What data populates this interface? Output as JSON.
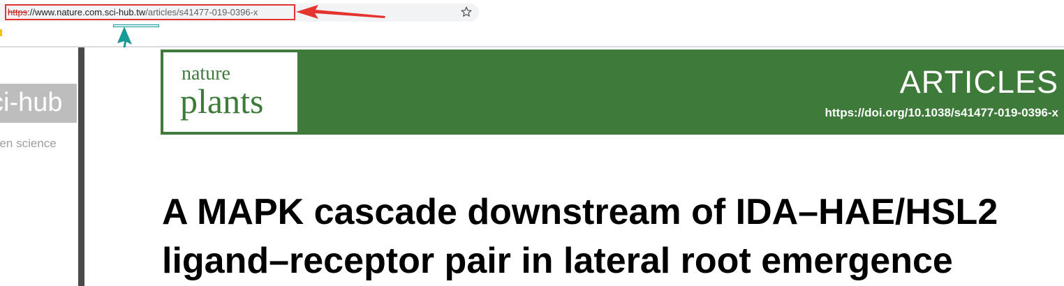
{
  "browser": {
    "url": {
      "scheme": "https",
      "separator": "://",
      "host": "www.nature.com.sci-hub.tw",
      "path": "/articles/s41477-019-0396-x"
    },
    "bookmark_icon": "star-icon",
    "annotation_colors": {
      "red": "#e5332f",
      "teal": "#1a9a96"
    }
  },
  "sidebar": {
    "logo_text": "ci-hub",
    "tagline": "pen science"
  },
  "article": {
    "journal": {
      "name_top": "nature",
      "name_bottom": "plants"
    },
    "section": "ARTICLES",
    "doi": "https://doi.org/10.1038/s41477-019-0396-x",
    "title_lines": [
      "A MAPK cascade downstream of IDA–HAE/HSL2",
      "ligand–receptor pair in lateral root emergence"
    ],
    "brand_color": "#3e7b3a"
  }
}
